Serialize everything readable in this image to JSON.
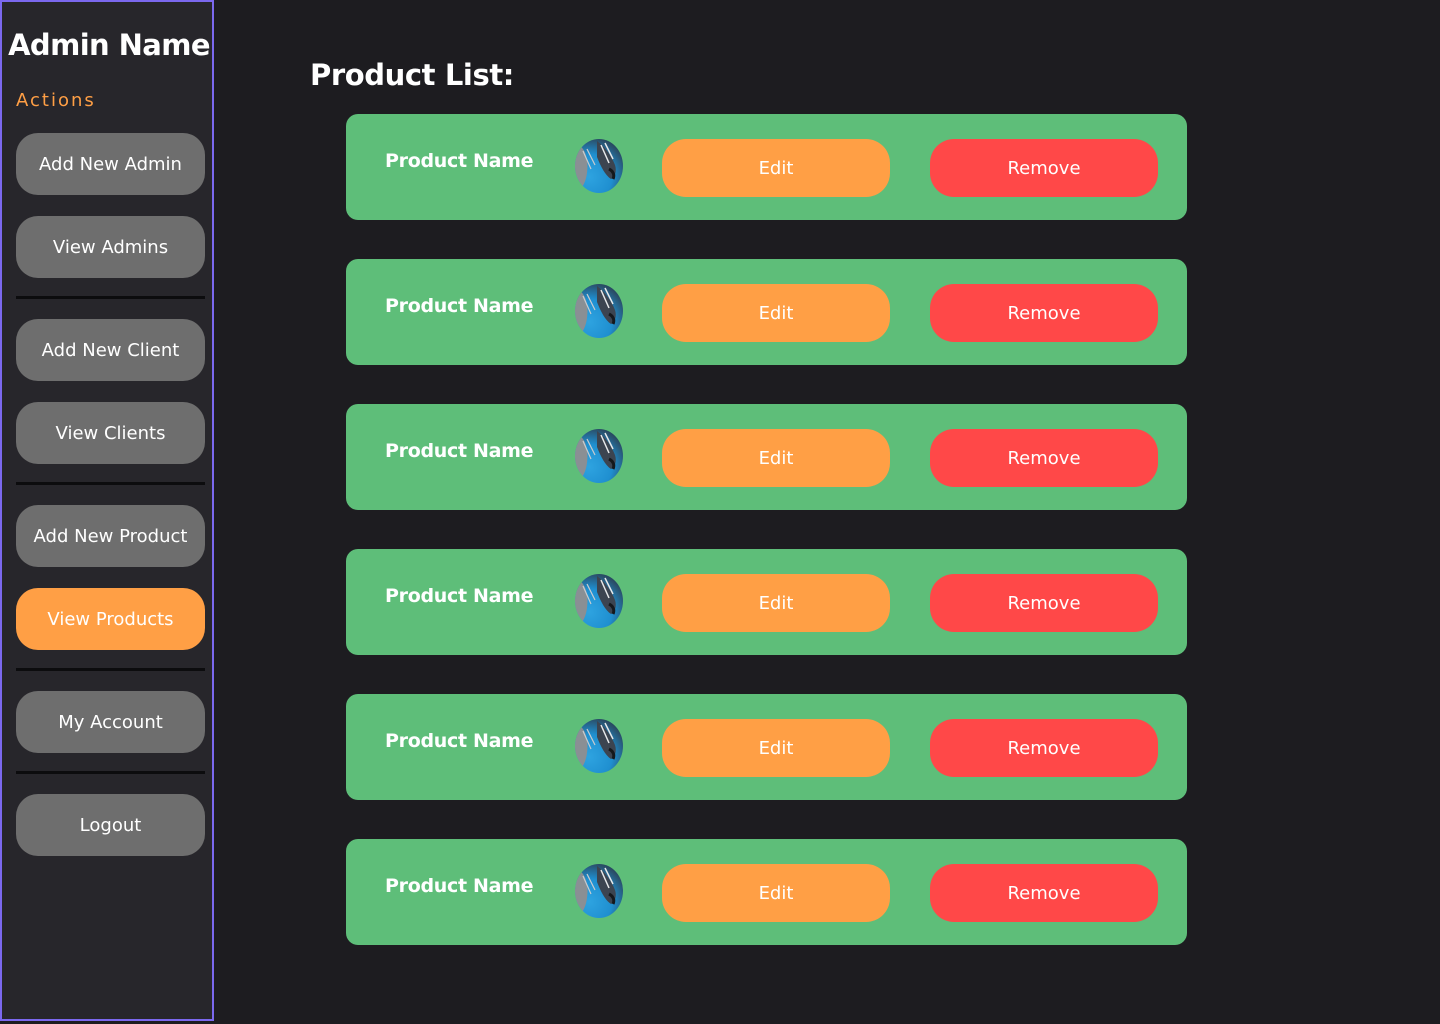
{
  "sidebar": {
    "admin_name": "Admin Name",
    "actions_label": "Actions",
    "items": [
      {
        "label": "Add New Admin",
        "active": false
      },
      {
        "label": "View Admins",
        "active": false
      },
      {
        "label": "Add New Client",
        "active": false
      },
      {
        "label": "View Clients",
        "active": false
      },
      {
        "label": "Add New Product",
        "active": false
      },
      {
        "label": "View Products",
        "active": true
      },
      {
        "label": "My Account",
        "active": false
      },
      {
        "label": "Logout",
        "active": false
      }
    ]
  },
  "main": {
    "title": "Product List:",
    "products": [
      {
        "name": "Product Name",
        "edit_label": "Edit",
        "remove_label": "Remove",
        "image_icon": "product-thumbnail"
      },
      {
        "name": "Product Name",
        "edit_label": "Edit",
        "remove_label": "Remove",
        "image_icon": "product-thumbnail"
      },
      {
        "name": "Product Name",
        "edit_label": "Edit",
        "remove_label": "Remove",
        "image_icon": "product-thumbnail"
      },
      {
        "name": "Product Name",
        "edit_label": "Edit",
        "remove_label": "Remove",
        "image_icon": "product-thumbnail"
      },
      {
        "name": "Product Name",
        "edit_label": "Edit",
        "remove_label": "Remove",
        "image_icon": "product-thumbnail"
      },
      {
        "name": "Product Name",
        "edit_label": "Edit",
        "remove_label": "Remove",
        "image_icon": "product-thumbnail"
      }
    ]
  },
  "colors": {
    "background": "#1d1c20",
    "sidebar": "#27262b",
    "sidebar_border": "#7b68ee",
    "accent": "#ff9f45",
    "button_gray": "#6e6e6e",
    "card_green": "#5ebe79",
    "remove_red": "#ff4848"
  }
}
